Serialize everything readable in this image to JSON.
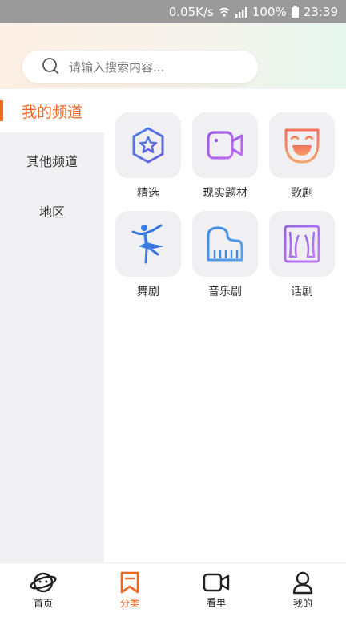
{
  "status_bar": {
    "speed": "0.05K/s",
    "battery": "100%",
    "time": "23:39"
  },
  "search": {
    "placeholder": "请输入搜索内容..."
  },
  "sidebar": {
    "items": [
      {
        "label": "我的频道",
        "active": true
      },
      {
        "label": "其他频道",
        "active": false
      },
      {
        "label": "地区",
        "active": false
      }
    ]
  },
  "categories": [
    {
      "label": "精选",
      "icon": "star-hexagon-icon"
    },
    {
      "label": "现实题材",
      "icon": "video-camera-icon"
    },
    {
      "label": "歌剧",
      "icon": "theater-mask-icon"
    },
    {
      "label": "舞剧",
      "icon": "ballet-dancer-icon"
    },
    {
      "label": "音乐剧",
      "icon": "piano-icon"
    },
    {
      "label": "话剧",
      "icon": "stage-curtain-icon"
    }
  ],
  "tabbar": {
    "tabs": [
      {
        "label": "首页",
        "icon": "planet-icon",
        "active": false
      },
      {
        "label": "分类",
        "icon": "bookmark-icon",
        "active": true
      },
      {
        "label": "看单",
        "icon": "video-icon",
        "active": false
      },
      {
        "label": "我的",
        "icon": "user-icon",
        "active": false
      }
    ]
  },
  "colors": {
    "accent": "#f26522",
    "sidebar_bg": "#f1f1f3",
    "tile_bg": "#f0f0f2"
  }
}
